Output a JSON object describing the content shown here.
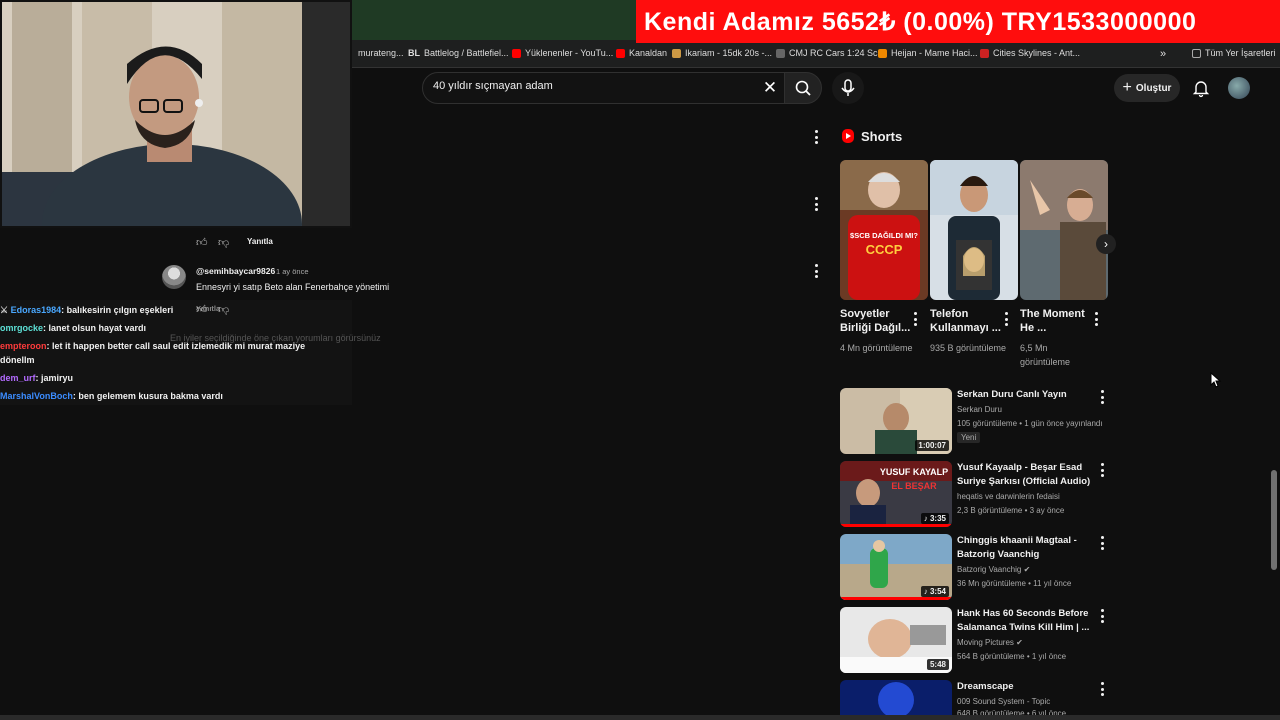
{
  "ticker": {
    "text": "Kendi Adamız   5652₺ (0.00%) TRY1533000000"
  },
  "bookmarks": [
    {
      "label": "murateng...",
      "color": "#555"
    },
    {
      "label": "Battlelog / Battlefiel...",
      "color": "#fff"
    },
    {
      "label": "Yüklenenler - YouTu...",
      "color": "#f00"
    },
    {
      "label": "Kanaldan",
      "color": "#f00"
    },
    {
      "label": "Ikariam - 15dk 20s -...",
      "color": "#c94"
    },
    {
      "label": "CMJ RC Cars 1:24 Sc...",
      "color": "#444"
    },
    {
      "label": "Heijan - Mame Haci...",
      "color": "#e80"
    },
    {
      "label": "Cities Skylines - Ant...",
      "color": "#c22"
    },
    {
      "label": "»",
      "color": ""
    },
    {
      "label": "Tüm Yer İşaretleri",
      "color": "#999"
    }
  ],
  "search": {
    "value": "40 yıldır sıçmayan adam",
    "placeholder": "Ara"
  },
  "header": {
    "create_label": "Oluştur"
  },
  "comments": {
    "reply_label": "Yanıtla",
    "comment2_author": "@semihbaycar9826",
    "comment2_time": "1 ay önce",
    "comment2_text": "Ennesyri yi satıp Beto alan Fenerbahçe yönetimi",
    "faded_notice": "En iyiler seçildiğinde öne çıkan yorumları görürsünüz"
  },
  "chat": [
    {
      "user": "Edoras1984",
      "color": "#4aa8ff",
      "message": ": balıkesirin çılgın eşekleri",
      "badge": "⚔"
    },
    {
      "user": "omrgocke",
      "color": "#5de0d6",
      "message": ": lanet olsun hayat vardı"
    },
    {
      "user": "empteroon",
      "color": "#ff3b3b",
      "message": ": let it happen better call saul edit izlemedik mi murat maziye"
    },
    {
      "user": "",
      "color": "#fff",
      "message": "dönellm"
    },
    {
      "user": "dem_urf",
      "color": "#b36bff",
      "message": ": jamiryu"
    },
    {
      "user": "MarshalVonBoch",
      "color": "#3b8cff",
      "message": ": ben gelemem kusura bakma vardı"
    }
  ],
  "shorts": {
    "heading": "Shorts",
    "items": [
      {
        "title": "Sovyetler Birliği Dağıl...",
        "views": "4 Mn görüntüleme",
        "overlay": "$SCB DAĞILDI MI?"
      },
      {
        "title": "Telefon Kullanmayı ...",
        "views": "935 B görüntüleme"
      },
      {
        "title": "The Moment He ...",
        "views": "6,5 Mn görüntüleme"
      }
    ]
  },
  "videos": [
    {
      "title": "Serkan Duru Canlı Yayın",
      "channel": "Serkan Duru",
      "stats": "105 görüntüleme • 1 gün önce yayınlandı",
      "badge": "Yeni",
      "duration": "1:00:07"
    },
    {
      "title": "Yusuf Kayaalp - Beşar Esad Suriye Şarkısı (Official Audio)",
      "channel": "heqatis ve darwinlerin fedaisi",
      "stats": "2,3 B görüntüleme • 3 ay önce",
      "duration": "3:35",
      "overlay": "YUSUF KAYALP EL BEŞAR"
    },
    {
      "title": "Chinggis khaanii Magtaal - Batzorig Vaanchig",
      "channel": "Batzorig Vaanchig",
      "stats": "36 Mn görüntüleme • 11 yıl önce",
      "duration": "3:54"
    },
    {
      "title": "Hank Has 60 Seconds Before Salamanca Twins Kill Him | ...",
      "channel": "Moving Pictures",
      "stats": "564 B görüntüleme • 1 yıl önce",
      "duration": "5:48"
    },
    {
      "title": "Dreamscape",
      "channel": "009 Sound System - Topic",
      "stats": "648 B görüntüleme • 6 yıl önce",
      "duration": ""
    }
  ]
}
